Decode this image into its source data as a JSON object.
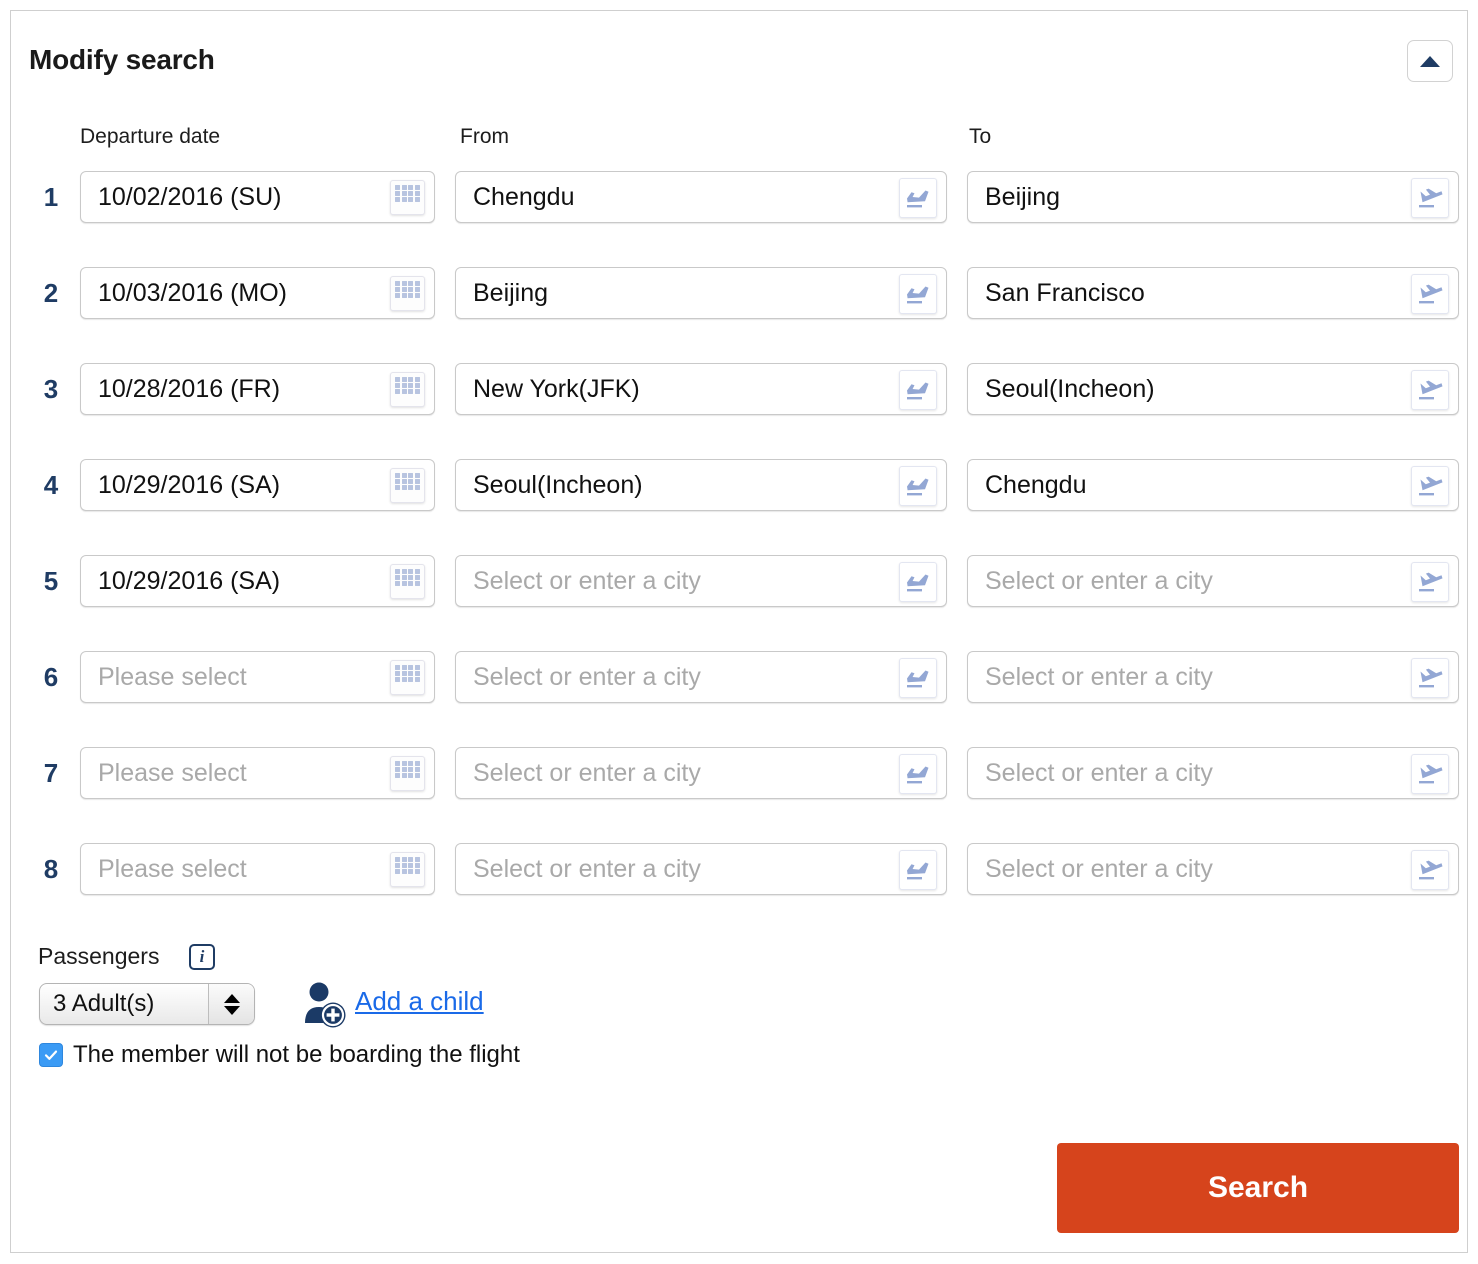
{
  "panel": {
    "title": "Modify search",
    "collapse_icon": "triangle-up-icon"
  },
  "columns": {
    "date": "Departure date",
    "from": "From",
    "to": "To"
  },
  "icons": {
    "calendar": "calendar-icon",
    "departure_plane": "plane-departure-icon",
    "arrival_plane": "plane-arrival-icon",
    "info": "info-icon",
    "info_glyph": "i",
    "add_child": "person-add-icon",
    "checkbox_check": "check-icon"
  },
  "placeholders": {
    "date": "Please select",
    "city": "Select or enter a city"
  },
  "rows": [
    {
      "num": "1",
      "date": "10/02/2016 (SU)",
      "from": "Chengdu",
      "to": "Beijing",
      "date_empty": false,
      "from_empty": false,
      "to_empty": false
    },
    {
      "num": "2",
      "date": "10/03/2016 (MO)",
      "from": "Beijing",
      "to": "San Francisco",
      "date_empty": false,
      "from_empty": false,
      "to_empty": false
    },
    {
      "num": "3",
      "date": "10/28/2016 (FR)",
      "from": "New York(JFK)",
      "to": "Seoul(Incheon)",
      "date_empty": false,
      "from_empty": false,
      "to_empty": false
    },
    {
      "num": "4",
      "date": "10/29/2016 (SA)",
      "from": "Seoul(Incheon)",
      "to": "Chengdu",
      "date_empty": false,
      "from_empty": false,
      "to_empty": false
    },
    {
      "num": "5",
      "date": "10/29/2016 (SA)",
      "from": "Select or enter a city",
      "to": "Select or enter a city",
      "date_empty": false,
      "from_empty": true,
      "to_empty": true
    },
    {
      "num": "6",
      "date": "Please select",
      "from": "Select or enter a city",
      "to": "Select or enter a city",
      "date_empty": true,
      "from_empty": true,
      "to_empty": true
    },
    {
      "num": "7",
      "date": "Please select",
      "from": "Select or enter a city",
      "to": "Select or enter a city",
      "date_empty": true,
      "from_empty": true,
      "to_empty": true
    },
    {
      "num": "8",
      "date": "Please select",
      "from": "Select or enter a city",
      "to": "Select or enter a city",
      "date_empty": true,
      "from_empty": true,
      "to_empty": true
    }
  ],
  "passengers": {
    "label": "Passengers",
    "adults_value": "3 Adult(s)",
    "add_child_label": "Add a child"
  },
  "member": {
    "checkbox_checked": true,
    "label": "The member will not be boarding the flight"
  },
  "actions": {
    "search_label": "Search"
  },
  "colors": {
    "accent_orange": "#d6441c",
    "navy": "#1f3c64",
    "link_blue": "#1a6ae8",
    "checkbox_blue": "#3b9bf5"
  }
}
